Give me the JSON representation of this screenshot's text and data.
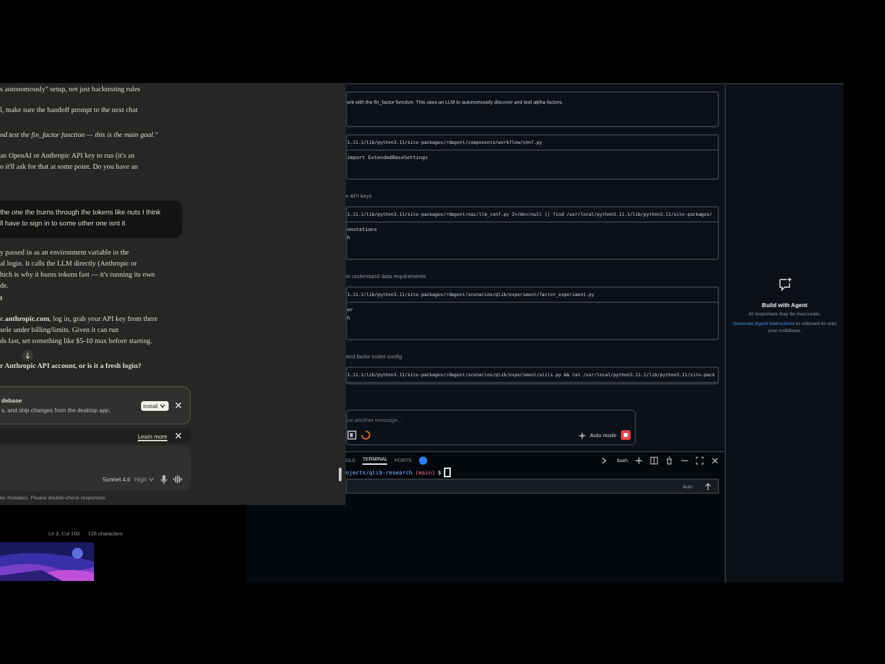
{
  "chat_window": {
    "messages": [
      {
        "kind": "text",
        "lines": [
          "s autonomously\" setup, not just backtesting rules"
        ]
      },
      {
        "kind": "text",
        "lines": [
          "l, make sure the handoff prompt to the next chat"
        ]
      },
      {
        "kind": "italic",
        "lines": [
          "nd test the fin_factor function — this is the main goal.\""
        ]
      },
      {
        "kind": "text",
        "lines": [
          "an OpenAI or Anthropic API key to run (it's an",
          "o it'll ask for that at some point. Do you have an"
        ]
      },
      {
        "kind": "user",
        "lines": [
          "the one the burns through the tokens like nuts I think",
          "ll have to sign in to some other one isnt it"
        ]
      },
      {
        "kind": "text",
        "lines": [
          "y passed in as an environment variable in the",
          "al login. It calls the LLM directly (Anthropic or",
          "hich is why it burns tokens fast — it's running its own",
          "de."
        ]
      },
      {
        "kind": "heading",
        "lines": [
          "t"
        ]
      },
      {
        "kind": "text",
        "lines": [
          "e.**anthropic.com**, log in, grab your API key from there",
          "sole under billing/limits. Given it can run",
          "ds fast, set something like $5-10 max before starting."
        ]
      },
      {
        "kind": "question",
        "lines": [
          "r Anthropic API account, or is it a fresh login?"
        ]
      }
    ],
    "banner": {
      "title": "debase",
      "description": "s, and ship changes from the desktop app.",
      "button": "Install"
    },
    "notice": {
      "link": "Learn more"
    },
    "composer": {
      "model": "Sonnet 4.6",
      "effort": "High"
    },
    "disclaimer": "ke mistakes. Please double-check responses."
  },
  "editor": {
    "blocks": [
      {
        "kind": "summary",
        "text": "ent with the fin_factor function. This uses an LLM to autonomously discover and test alpha factors."
      },
      {
        "kind": "code",
        "header": "1.11.1/lib/python3.11/site-packages/rdagent/components/workflow/conf.py",
        "lines": [
          "import ExtendedBaseSettings"
        ]
      },
      {
        "kind": "caption",
        "text": "e API keys"
      },
      {
        "kind": "code",
        "header": "1.11.1/lib/python3.11/site-packages/rdagent/oai/llm_conf.py 2>/dev/null || find /usr/local/python3.11.1/lib/python3.11/site-packages/",
        "lines": [
          "nnotations",
          "h"
        ]
      },
      {
        "kind": "caption",
        "text": "to understand data requirements"
      },
      {
        "kind": "code",
        "header": "1.11.1/lib/python3.11/site-packages/rdagent/scenarios/qlib/experiment/factor_experiment.py",
        "lines": [
          "er",
          "h"
        ]
      },
      {
        "kind": "caption",
        "text": "and factor coder config"
      },
      {
        "kind": "code",
        "header": "1.11.1/lib/python3.11/site-packages/rdagent/scenarios/qlib/experiment/utils.py && cat /usr/local/python3.11.1/lib/python3.11/site-pack"
      }
    ],
    "composer": {
      "placeholder": "ue another message...",
      "mode": "Auto mode"
    },
    "terminal": {
      "tabs": [
        {
          "label": "OLE",
          "selected": false
        },
        {
          "label": "TERMINAL",
          "selected": true
        },
        {
          "label": "PORTS",
          "selected": false
        }
      ],
      "shell": "bash",
      "path": "ojects/qlib-research",
      "branch": "(main)",
      "prompt": "$",
      "input": "Auto"
    },
    "agent_panel": {
      "title": "Build with Agent",
      "note": "AI responses may be inaccurate.",
      "link": "Generate Agent Instructions",
      "rest": "to onboard AI onto your codebase."
    }
  },
  "status": {
    "position": "Ln 3, Col 100",
    "count": "126 characters"
  }
}
